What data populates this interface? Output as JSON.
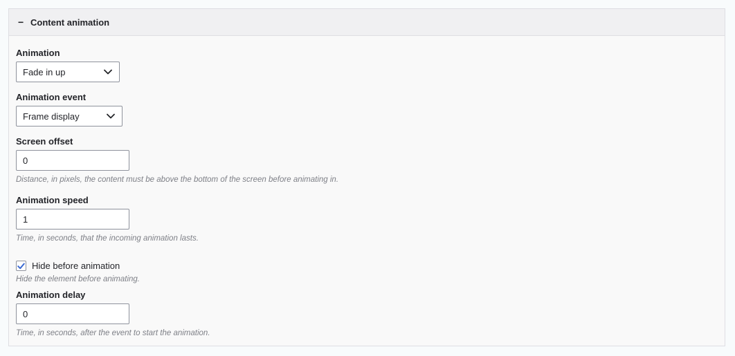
{
  "details": {
    "title": "Content animation",
    "collapse_icon": "minus-icon"
  },
  "fields": {
    "animation": {
      "label": "Animation",
      "value": "Fade in up"
    },
    "animation_event": {
      "label": "Animation event",
      "value": "Frame display"
    },
    "screen_offset": {
      "label": "Screen offset",
      "value": "0",
      "description": "Distance, in pixels, the content must be above the bottom of the screen before animating in."
    },
    "animation_speed": {
      "label": "Animation speed",
      "value": "1",
      "description": "Time, in seconds, that the incoming animation lasts."
    },
    "hide_before_animation": {
      "label": "Hide before animation",
      "checked": true,
      "description": "Hide the element before animating."
    },
    "animation_delay": {
      "label": "Animation delay",
      "value": "0",
      "description": "Time, in seconds, after the event to start the animation."
    }
  },
  "colors": {
    "accent": "#3b6ad2",
    "border": "#8e929c",
    "description_text": "#7d7f86"
  }
}
